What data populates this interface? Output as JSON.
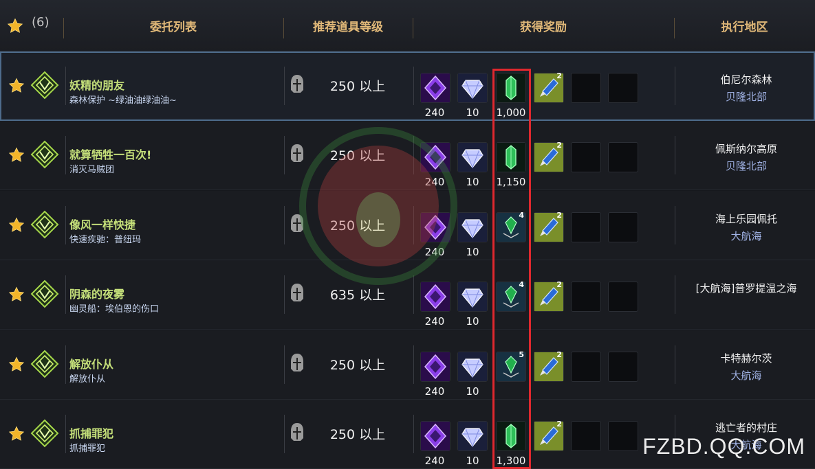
{
  "header": {
    "count": "(6)",
    "col_quest": "委托列表",
    "col_level": "推荐道具等级",
    "col_reward": "获得奖励",
    "col_location": "执行地区"
  },
  "rows": [
    {
      "title": "妖精的朋友",
      "subtitle": "森林保护 ~绿油油绿油油~",
      "level": "250 以上",
      "r1": "240",
      "r2": "10",
      "r3": "1,000",
      "r3_badge": "",
      "r4_badge": "2",
      "loc1": "伯尼尔森林",
      "loc2": "贝隆北部"
    },
    {
      "title": "就算牺牲一百次!",
      "subtitle": "消灭马贼团",
      "level": "250 以上",
      "r1": "240",
      "r2": "10",
      "r3": "1,150",
      "r3_badge": "",
      "r4_badge": "2",
      "loc1": "佩斯纳尔高原",
      "loc2": "贝隆北部"
    },
    {
      "title": "像风一样快捷",
      "subtitle": "快速疾驰：普纽玛",
      "level": "250 以上",
      "r1": "240",
      "r2": "10",
      "r3": "",
      "r3_badge": "4",
      "r4_badge": "2",
      "loc1": "海上乐园佩托",
      "loc2": "大航海"
    },
    {
      "title": "阴森的夜雾",
      "subtitle": "幽灵船：埃伯恩的伤口",
      "level": "635 以上",
      "r1": "240",
      "r2": "10",
      "r3": "",
      "r3_badge": "4",
      "r4_badge": "2",
      "loc1": "[大航海]普罗提温之海",
      "loc2": ""
    },
    {
      "title": "解放仆从",
      "subtitle": "解放仆从",
      "level": "250 以上",
      "r1": "240",
      "r2": "10",
      "r3": "",
      "r3_badge": "5",
      "r4_badge": "2",
      "loc1": "卡特赫尔茨",
      "loc2": "大航海"
    },
    {
      "title": "抓捕罪犯",
      "subtitle": "抓捕罪犯",
      "level": "250 以上",
      "r1": "240",
      "r2": "10",
      "r3": "1,300",
      "r3_badge": "",
      "r4_badge": "2",
      "loc1": "逃亡者的村庄",
      "loc2": "大航海"
    }
  ],
  "watermark": "FZBD.QQ.COM",
  "colors": {
    "title": "#c5e07a",
    "location_region": "#9fb1e3",
    "header_text": "#e0b878",
    "highlight_box": "#e0282e"
  }
}
